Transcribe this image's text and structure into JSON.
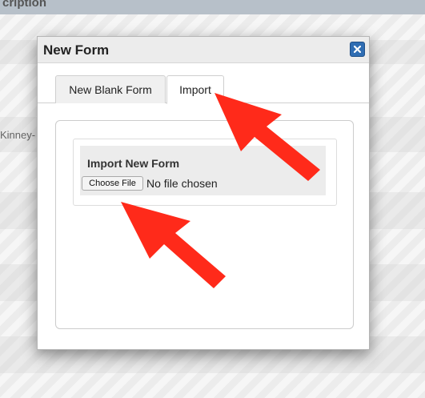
{
  "background": {
    "header_text": "cription",
    "cell_text": "Kinney-"
  },
  "modal": {
    "title": "New Form",
    "close_icon": "close-icon",
    "tabs": [
      {
        "label": "New Blank Form",
        "active": false
      },
      {
        "label": "Import",
        "active": true
      }
    ],
    "import_section": {
      "heading": "Import New Form",
      "choose_file_label": "Choose File",
      "file_status": "No file chosen"
    }
  },
  "annotations": {
    "arrow_color": "#ff2a1a",
    "arrows": [
      "pointing-to-import-tab",
      "pointing-to-choose-file-button"
    ]
  },
  "colors": {
    "close_button_bg": "#2f6db3",
    "modal_titlebar_bg": "#ececec"
  }
}
